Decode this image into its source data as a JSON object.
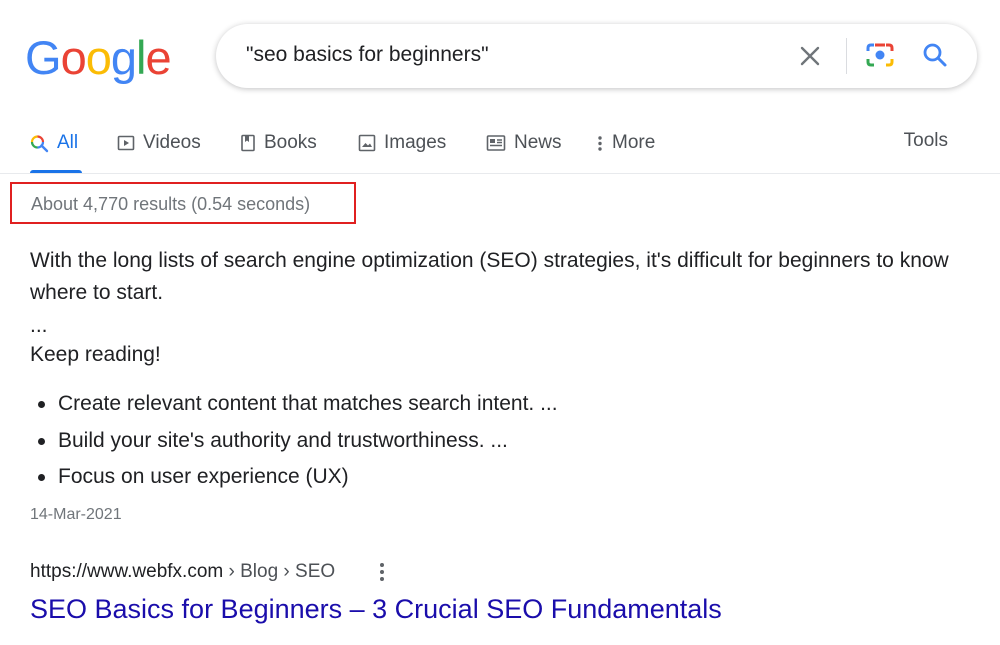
{
  "logo": {
    "letters": [
      "G",
      "o",
      "o",
      "g",
      "l",
      "e"
    ],
    "colors": [
      "#4285F4",
      "#EA4335",
      "#FBBC05",
      "#4285F4",
      "#34A853",
      "#EA4335"
    ]
  },
  "search": {
    "query": "\"seo basics for beginners\""
  },
  "tabs": [
    {
      "label": "All",
      "icon": "search-multicolor-icon",
      "active": true
    },
    {
      "label": "Videos",
      "icon": "play-icon"
    },
    {
      "label": "Books",
      "icon": "book-icon"
    },
    {
      "label": "Images",
      "icon": "image-icon"
    },
    {
      "label": "News",
      "icon": "newspaper-icon"
    },
    {
      "label": "More",
      "icon": "more-vert-icon"
    }
  ],
  "tools_label": "Tools",
  "result_stats": "About 4,770 results (0.54 seconds)",
  "featured": {
    "snippet": "With the long lists of search engine optimization (SEO) strategies, it's difficult for beginners to know where to start.",
    "ellipsis": "...",
    "keep_reading": "Keep reading!",
    "bullets": [
      "Create relevant content that matches search intent. ...",
      "Build your site's authority and trustworthiness. ...",
      "Focus on user experience (UX)"
    ],
    "date": "14-Mar-2021"
  },
  "result": {
    "domain": "https://www.webfx.com",
    "path": " › Blog › SEO",
    "title": "SEO Basics for Beginners – 3 Crucial SEO Fundamentals"
  },
  "colors": {
    "accent": "#1a73e8",
    "link": "#1a0dab",
    "highlight_box": "#e02020"
  }
}
